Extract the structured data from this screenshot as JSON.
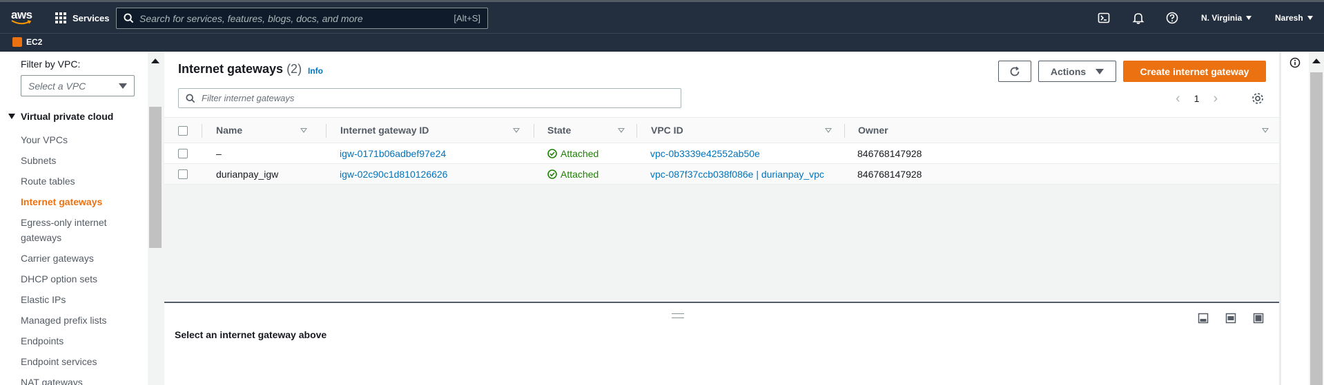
{
  "topnav": {
    "logo_text": "aws",
    "services_label": "Services",
    "search_placeholder": "Search for services, features, blogs, docs, and more",
    "search_shortcut": "[Alt+S]",
    "region": "N. Virginia",
    "user": "Naresh"
  },
  "subnav": {
    "service": "EC2"
  },
  "sidebar": {
    "filter_label": "Filter by VPC:",
    "filter_placeholder": "Select a VPC",
    "section_title": "Virtual private cloud",
    "items": [
      {
        "label": "Your VPCs",
        "active": false
      },
      {
        "label": "Subnets",
        "active": false
      },
      {
        "label": "Route tables",
        "active": false
      },
      {
        "label": "Internet gateways",
        "active": true
      },
      {
        "label": "Egress-only internet gateways",
        "active": false
      },
      {
        "label": "Carrier gateways",
        "active": false
      },
      {
        "label": "DHCP option sets",
        "active": false
      },
      {
        "label": "Elastic IPs",
        "active": false
      },
      {
        "label": "Managed prefix lists",
        "active": false
      },
      {
        "label": "Endpoints",
        "active": false
      },
      {
        "label": "Endpoint services",
        "active": false
      },
      {
        "label": "NAT gateways",
        "active": false
      }
    ]
  },
  "main": {
    "title": "Internet gateways",
    "count": "(2)",
    "info_label": "Info",
    "actions_label": "Actions",
    "create_label": "Create internet gateway",
    "filter_placeholder": "Filter internet gateways",
    "page_number": "1",
    "columns": [
      "Name",
      "Internet gateway ID",
      "State",
      "VPC ID",
      "Owner"
    ],
    "rows": [
      {
        "name": "–",
        "igw_id": "igw-0171b06adbef97e24",
        "state": "Attached",
        "vpc_id": "vpc-0b3339e42552ab50e",
        "owner": "846768147928"
      },
      {
        "name": "durianpay_igw",
        "igw_id": "igw-02c90c1d810126626",
        "state": "Attached",
        "vpc_id": "vpc-087f37ccb038f086e | durianpay_vpc",
        "owner": "846768147928"
      }
    ]
  },
  "split_panel": {
    "message": "Select an internet gateway above"
  },
  "colors": {
    "nav_bg": "#232f3e",
    "accent_orange": "#ec7211",
    "link_blue": "#0073bb",
    "success_green": "#1d8102"
  }
}
